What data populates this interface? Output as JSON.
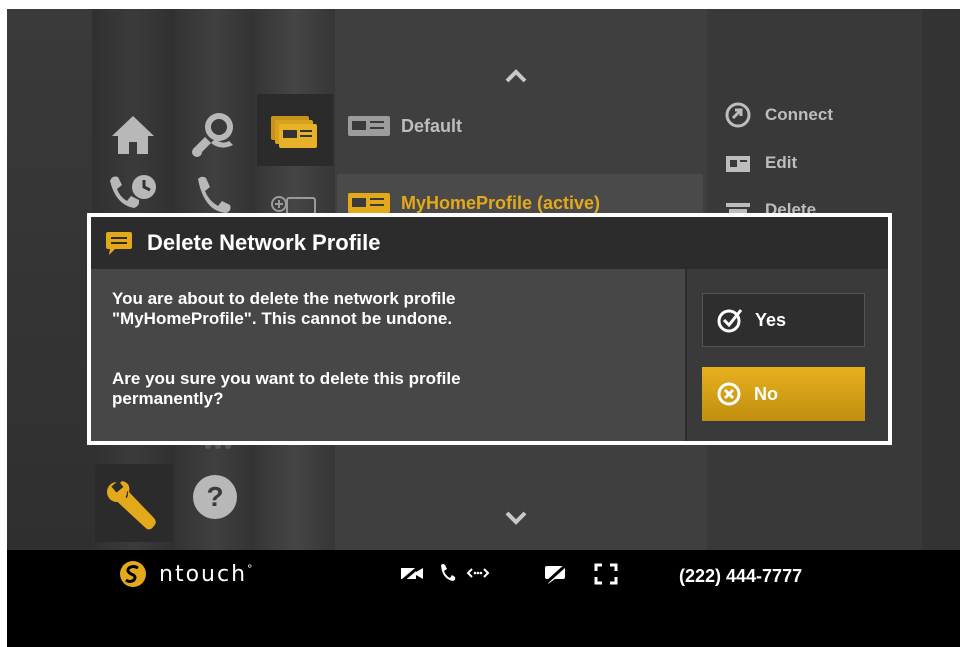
{
  "colors": {
    "accent": "#E0A91C",
    "dialog_border": "#FFFFFF",
    "dialog_bg": "#474747",
    "text": "#FFFFFF"
  },
  "nav_icons": [
    "home-icon",
    "settings-person-icon",
    "network-profiles-icon",
    "call-history-icon",
    "phone-settings-icon",
    "add-profile-icon",
    "wrench-icon",
    "help-icon"
  ],
  "profiles": {
    "items": [
      {
        "label": "Default",
        "active": false
      },
      {
        "label": "MyHomeProfile (active)",
        "active": true
      }
    ]
  },
  "actions": [
    {
      "label": "Connect",
      "icon": "connect-icon"
    },
    {
      "label": "Edit",
      "icon": "edit-icon"
    },
    {
      "label": "Delete",
      "icon": "delete-icon"
    }
  ],
  "dialog": {
    "title": "Delete Network Profile",
    "message_line1": "You are about to delete the network profile",
    "message_line2": "\"MyHomeProfile\". This cannot be undone.",
    "question_line1": "Are you sure you want to delete this profile",
    "question_line2": "permanently?",
    "yes_label": "Yes",
    "no_label": "No"
  },
  "status": {
    "brand": "ntouch",
    "brand_mark": "°",
    "phone_number": "(222) 444-7777",
    "icons": [
      "video-off-icon",
      "phone-icon",
      "connection-icon",
      "chat-off-icon",
      "fullscreen-icon"
    ]
  }
}
